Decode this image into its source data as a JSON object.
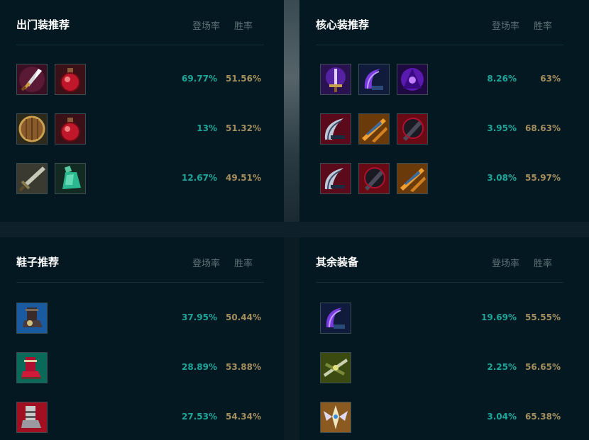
{
  "panels": {
    "starter": {
      "title": "出门装推荐",
      "col_pick": "登场率",
      "col_win": "胜率",
      "rows": [
        {
          "items": [
            "dagger-icon",
            "health-potion-icon"
          ],
          "pick": "69.77%",
          "win": "51.56%"
        },
        {
          "items": [
            "wooden-shield-icon",
            "health-potion-icon"
          ],
          "pick": "13%",
          "win": "51.32%"
        },
        {
          "items": [
            "long-sword-icon",
            "refillable-potion-icon"
          ],
          "pick": "12.67%",
          "win": "49.51%"
        }
      ]
    },
    "core": {
      "title": "核心装推荐",
      "col_pick": "登场率",
      "col_win": "胜率",
      "rows": [
        {
          "items": [
            "purple-sword-icon",
            "purple-hook-blade-icon",
            "violet-hood-icon"
          ],
          "pick": "8.26%",
          "win": "63%"
        },
        {
          "items": [
            "crimson-scythe-icon",
            "golden-blades-icon",
            "black-cleaver-icon"
          ],
          "pick": "3.95%",
          "win": "68.63%"
        },
        {
          "items": [
            "crimson-scythe-icon",
            "black-cleaver-icon",
            "golden-blades-icon"
          ],
          "pick": "3.08%",
          "win": "55.97%"
        }
      ]
    },
    "boots": {
      "title": "鞋子推荐",
      "col_pick": "登场率",
      "col_win": "胜率",
      "rows": [
        {
          "items": [
            "blue-boots-icon"
          ],
          "pick": "37.95%",
          "win": "50.44%"
        },
        {
          "items": [
            "red-boots-icon"
          ],
          "pick": "28.89%",
          "win": "53.88%"
        },
        {
          "items": [
            "armored-boots-icon"
          ],
          "pick": "27.53%",
          "win": "54.34%"
        }
      ]
    },
    "other": {
      "title": "其余装备",
      "col_pick": "登场率",
      "col_win": "胜率",
      "rows": [
        {
          "items": [
            "purple-hook-blade-icon"
          ],
          "pick": "19.69%",
          "win": "55.55%"
        },
        {
          "items": [
            "green-crossbow-icon"
          ],
          "pick": "2.25%",
          "win": "56.65%"
        },
        {
          "items": [
            "winged-crest-icon"
          ],
          "pick": "3.04%",
          "win": "65.38%"
        }
      ]
    }
  }
}
